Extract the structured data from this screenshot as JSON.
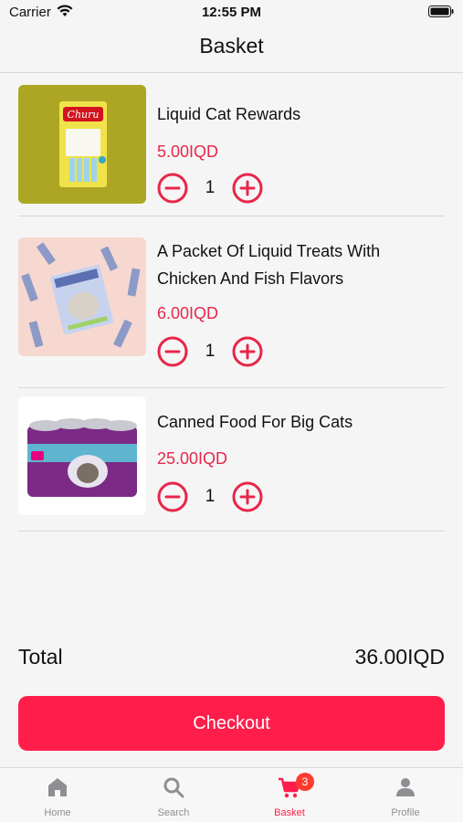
{
  "status_bar": {
    "carrier": "Carrier",
    "time": "12:55 PM"
  },
  "header": {
    "title": "Basket"
  },
  "cart": {
    "items": [
      {
        "name": "Liquid Cat Rewards",
        "price": "5.00IQD",
        "quantity": "1",
        "image": "churu-cat-treats-pack"
      },
      {
        "name": "A Packet Of Liquid Treats With Chicken And Fish Flavors",
        "price": "6.00IQD",
        "quantity": "1",
        "image": "liquid-treat-packets"
      },
      {
        "name": "Canned Food For Big Cats",
        "price": "25.00IQD",
        "quantity": "1",
        "image": "whiskas-cans-pack"
      }
    ]
  },
  "summary": {
    "total_label": "Total",
    "total_value": "36.00IQD"
  },
  "checkout": {
    "label": "Checkout"
  },
  "tabs": [
    {
      "label": "Home",
      "icon": "home-icon"
    },
    {
      "label": "Search",
      "icon": "search-icon"
    },
    {
      "label": "Basket",
      "icon": "cart-icon",
      "badge": "3",
      "active": true
    },
    {
      "label": "Profile",
      "icon": "person-icon"
    }
  ],
  "colors": {
    "accent": "#ff1e4b",
    "price": "#e8264a",
    "badge": "#ff3b30",
    "inactive_tab": "#8e8e93"
  }
}
